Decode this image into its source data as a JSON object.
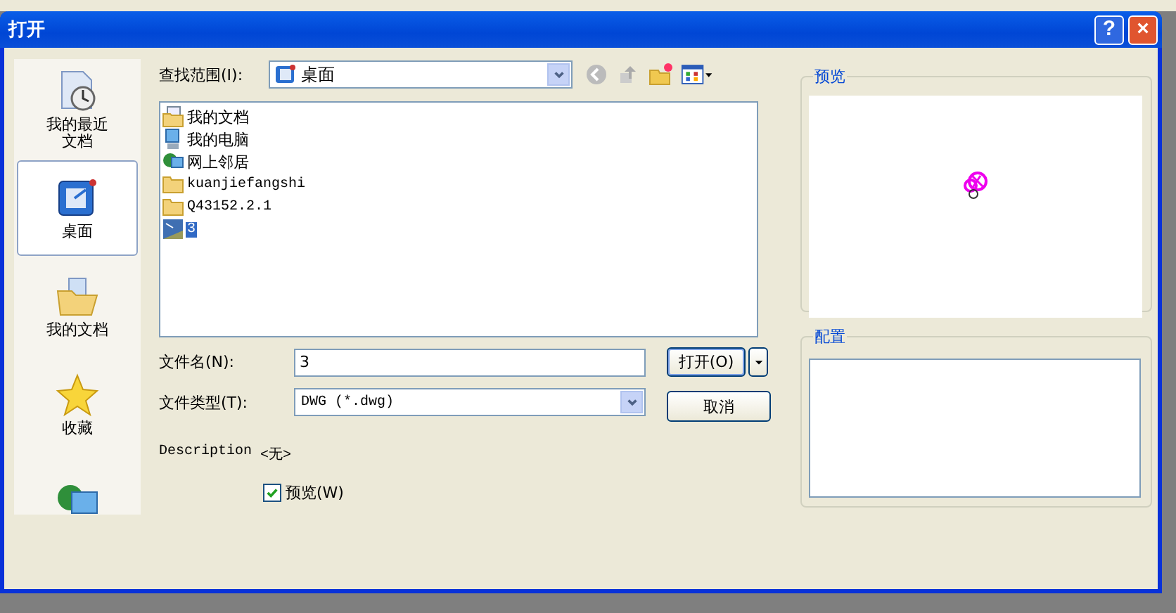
{
  "window": {
    "title": "打开"
  },
  "title_buttons": [
    {
      "kind": "help",
      "label": "?"
    },
    {
      "kind": "close",
      "label": "×"
    }
  ],
  "places": [
    {
      "kind": "recent",
      "label": "我的最近文档",
      "selected": false
    },
    {
      "kind": "desktop",
      "label": "桌面",
      "selected": true
    },
    {
      "kind": "documents",
      "label": "我的文档",
      "selected": false
    },
    {
      "kind": "favorites",
      "label": "收藏",
      "selected": false
    },
    {
      "kind": "network",
      "selected": false
    }
  ],
  "look_in": {
    "label": "查找范围(I):",
    "value": "桌面"
  },
  "files": [
    {
      "kind": "documents",
      "name": "我的文档",
      "selected": false
    },
    {
      "kind": "computer",
      "name": "我的电脑",
      "selected": false
    },
    {
      "kind": "network",
      "name": "网上邻居",
      "selected": false
    },
    {
      "kind": "folder",
      "name": "kuanjiefangshi",
      "selected": false
    },
    {
      "kind": "folder",
      "name": "Q43152.2.1",
      "selected": false
    },
    {
      "kind": "dwg",
      "name": "3",
      "selected": true
    }
  ],
  "file_name": {
    "label": "文件名(N):",
    "value": "3"
  },
  "file_type": {
    "label": "文件类型(T):",
    "value": "DWG (*.dwg)"
  },
  "open_button": "打开(O)",
  "cancel_button": "取消",
  "description": {
    "label": "Description",
    "value": "<无>"
  },
  "preview_checkbox": {
    "label": "预览(W)",
    "checked": true
  },
  "preview_group": {
    "title": "预览"
  },
  "config_group": {
    "title": "配置"
  }
}
